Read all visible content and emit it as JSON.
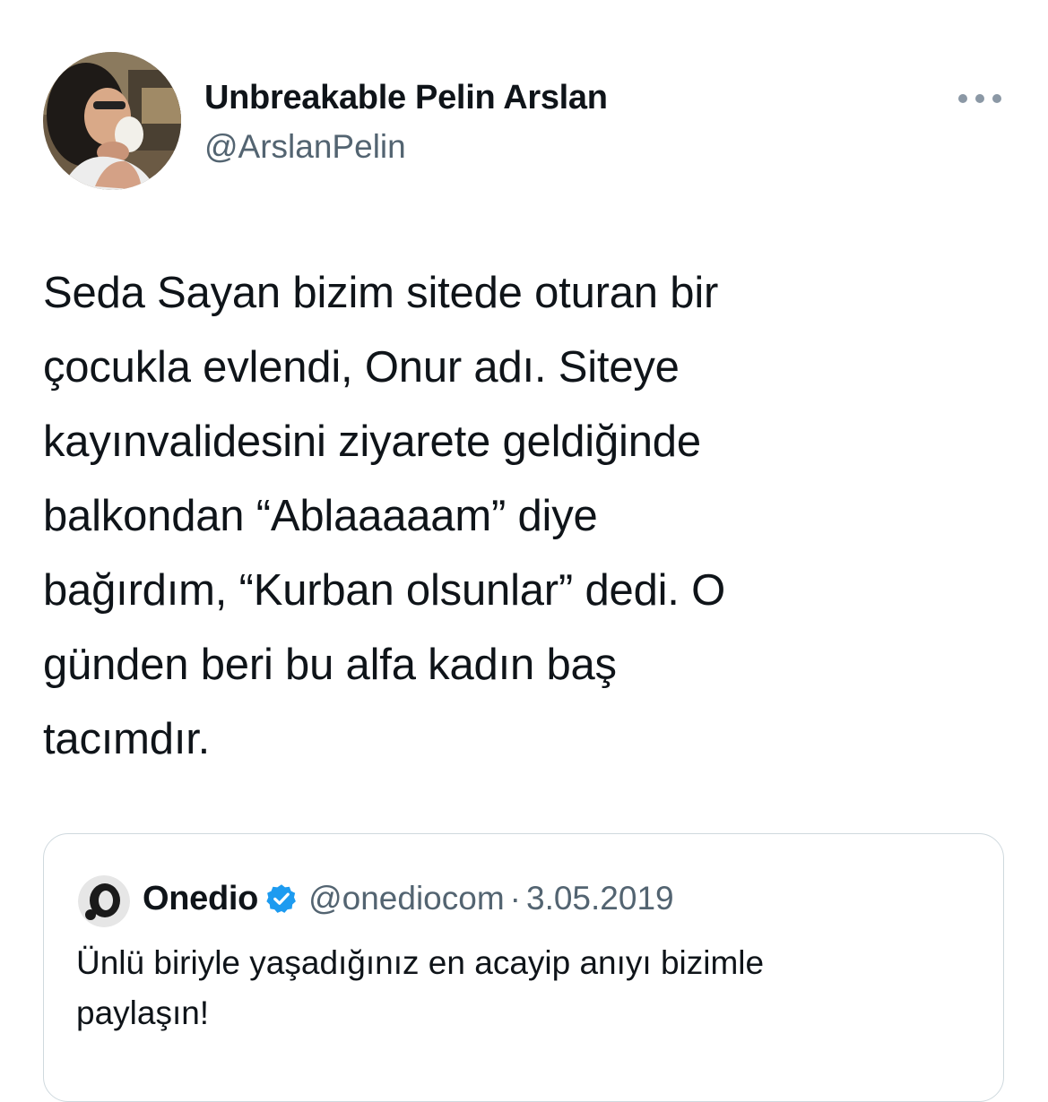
{
  "tweet": {
    "author": {
      "display_name": "Unbreakable Pelin Arslan",
      "handle": "@ArslanPelin"
    },
    "more_icon": "more-horizontal-icon",
    "text": "Seda Sayan bizim sitede oturan bir\nçocukla evlendi, Onur adı. Siteye\nkayınvalidesini ziyarete geldiğinde\nbalkondan “Ablaaaaam” diye\nbağırdım, “Kurban olsunlar” dedi. O\ngünden beri bu alfa kadın baş\ntacımdır."
  },
  "quoted_tweet": {
    "display_name": "Onedio",
    "verified_icon": "verified-badge-icon",
    "handle": "@onediocom",
    "separator": "·",
    "date": "3.05.2019",
    "text": "Ünlü biriyle yaşadığınız en acayip anıyı bizimle\npaylaşın!"
  },
  "colors": {
    "text_primary": "#0f1419",
    "text_secondary": "#536471",
    "border": "#cfd9de",
    "verified_blue": "#1d9bf0"
  }
}
